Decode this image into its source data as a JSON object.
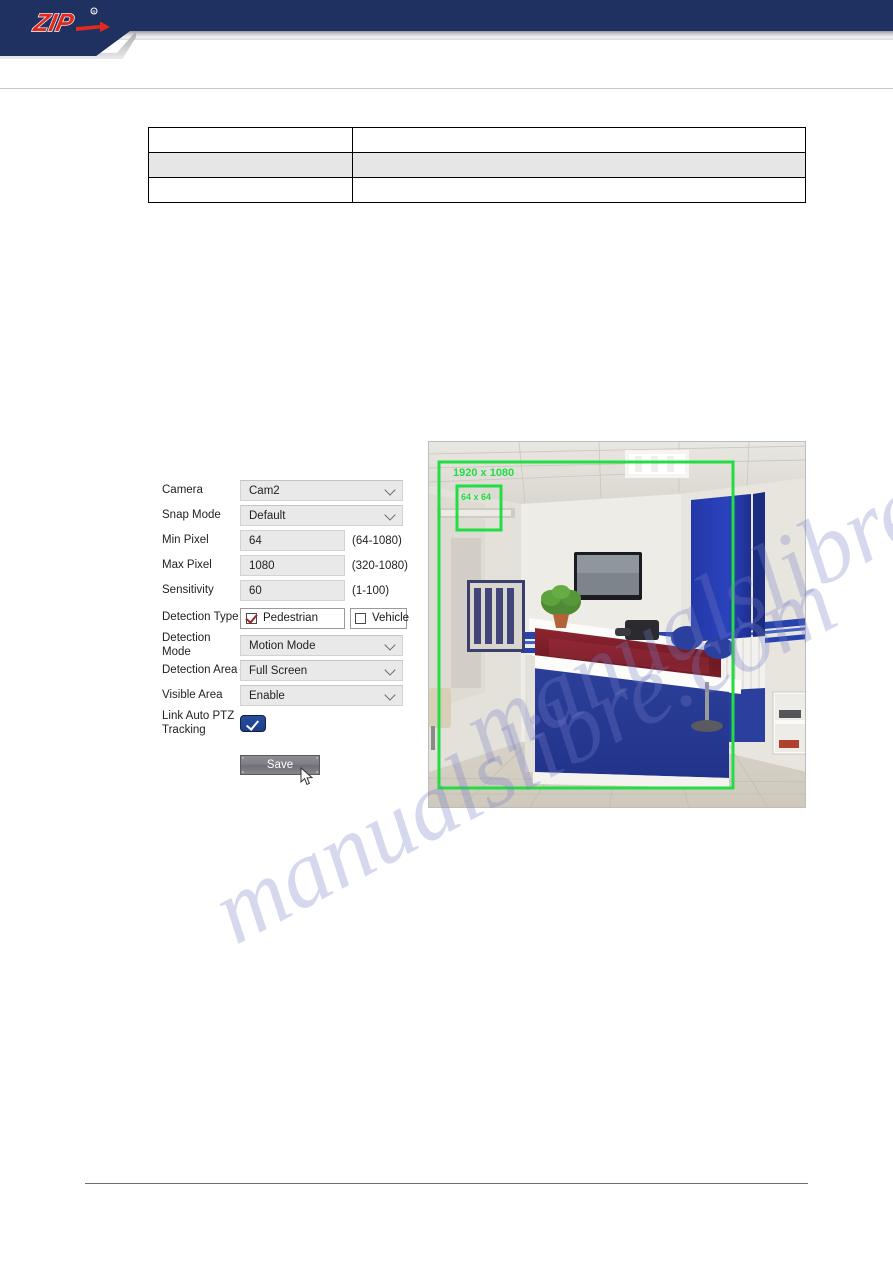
{
  "header": {
    "brand": "ZIP",
    "brand_mark": "®",
    "bg_navy": "#1e3160",
    "logo_red": "#e02a20"
  },
  "doc_table": {
    "rows": [
      {
        "shaded": false,
        "cells": [
          "",
          ""
        ]
      },
      {
        "shaded": true,
        "cells": [
          "",
          ""
        ]
      },
      {
        "shaded": false,
        "cells": [
          "",
          ""
        ]
      }
    ]
  },
  "settings_form": {
    "fields": {
      "camera": {
        "label": "Camera",
        "value": "Cam2",
        "type": "select"
      },
      "snap_mode": {
        "label": "Snap Mode",
        "value": "Default",
        "type": "select"
      },
      "min_pixel": {
        "label": "Min Pixel",
        "value": "64",
        "hint": "(64-1080)",
        "type": "text"
      },
      "max_pixel": {
        "label": "Max Pixel",
        "value": "1080",
        "hint": "(320-1080)",
        "type": "text"
      },
      "sensitivity": {
        "label": "Sensitivity",
        "value": "60",
        "hint": "(1-100)",
        "type": "text"
      },
      "detection_type": {
        "label": "Detection Type",
        "options": [
          {
            "label": "Pedestrian",
            "checked": true
          },
          {
            "label": "Vehicle",
            "checked": false
          }
        ]
      },
      "detection_mode": {
        "label": "Detection Mode",
        "value": "Motion Mode",
        "type": "select"
      },
      "detection_area": {
        "label": "Detection Area",
        "value": "Full Screen",
        "type": "select"
      },
      "visible_area": {
        "label": "Visible Area",
        "value": "Enable",
        "type": "select"
      },
      "link_auto_ptz": {
        "label": "Link Auto PTZ Tracking",
        "checked": true,
        "type": "toggle"
      }
    },
    "save_label": "Save"
  },
  "video_preview": {
    "max_box_label": "1920 x 1080",
    "min_box_label": "64 x 64",
    "overlay_color": "#22dd44",
    "scene": "office reception desk"
  },
  "watermark": {
    "text": "manualslibre.com",
    "color": "#787dc8"
  }
}
